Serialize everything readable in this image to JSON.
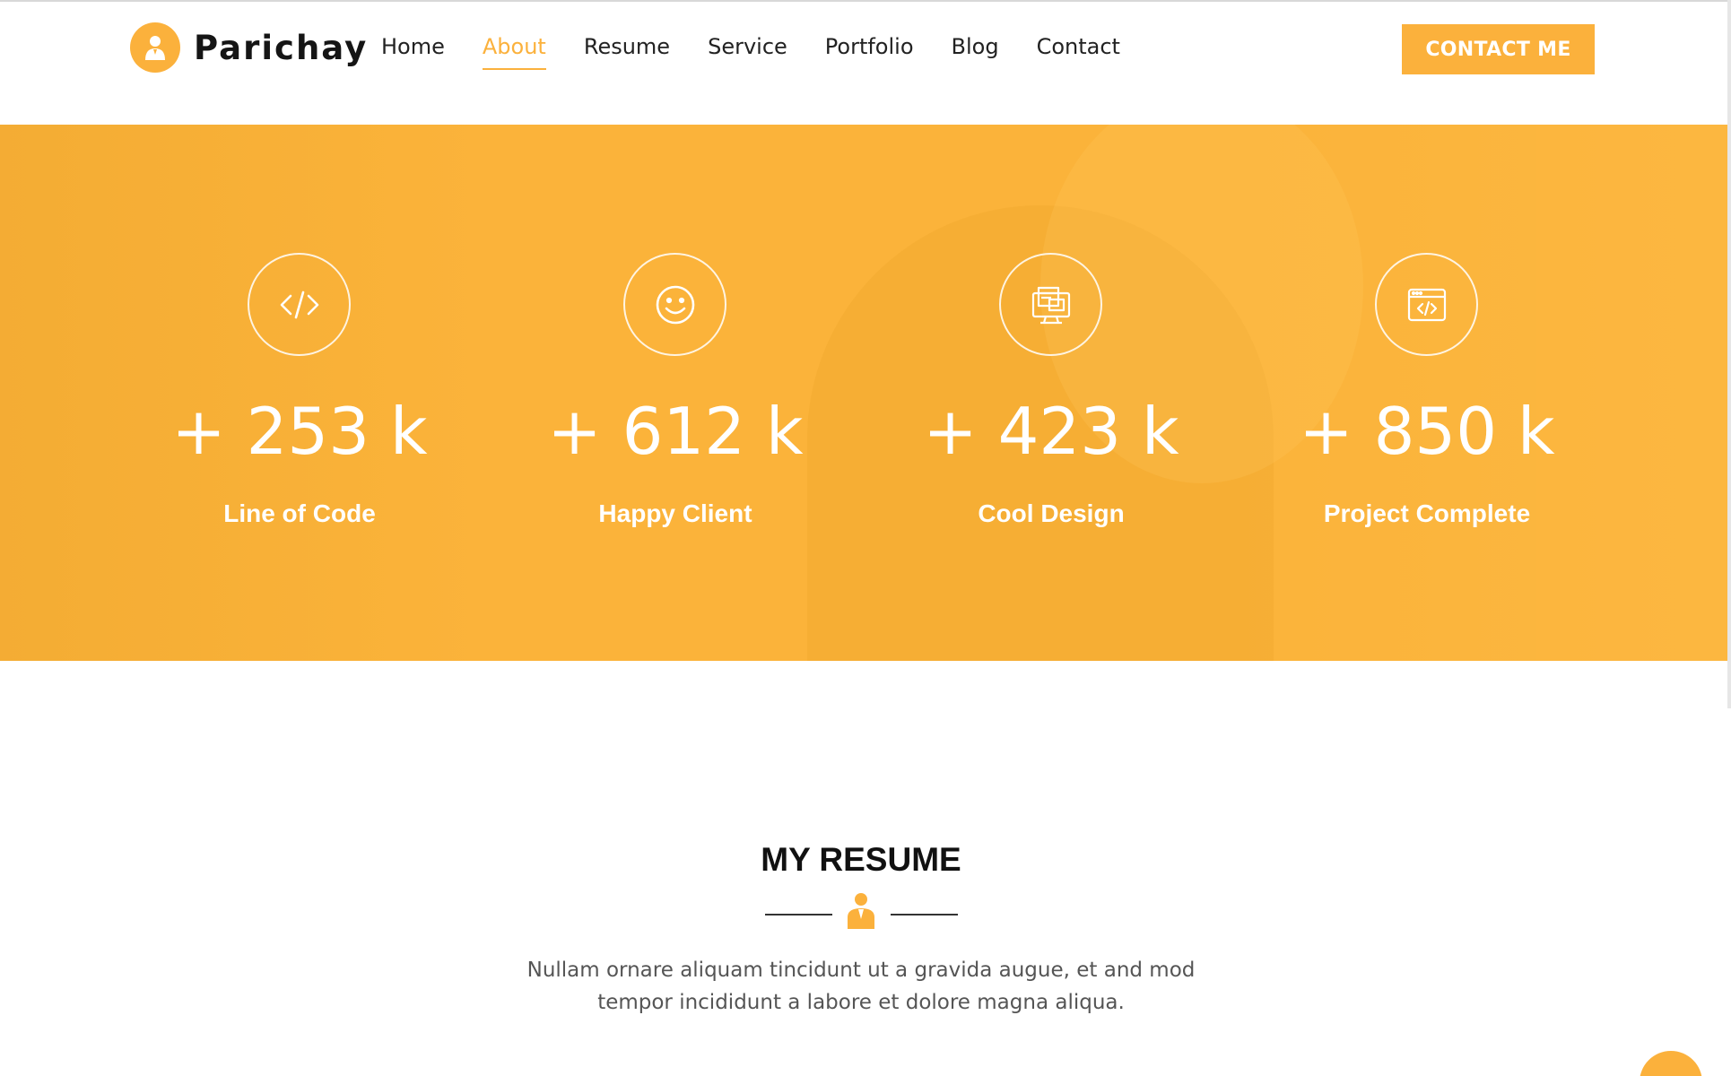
{
  "brand": {
    "name": "Parichay",
    "icon": "person-icon"
  },
  "nav": {
    "items": [
      {
        "label": "Home"
      },
      {
        "label": "About",
        "active": true
      },
      {
        "label": "Resume"
      },
      {
        "label": "Service"
      },
      {
        "label": "Portfolio"
      },
      {
        "label": "Blog"
      },
      {
        "label": "Contact"
      }
    ],
    "cta": "CONTACT ME"
  },
  "counters": [
    {
      "icon": "code-icon",
      "value": "+ 253 k",
      "label": "Line of Code"
    },
    {
      "icon": "smiley-icon",
      "value": "+ 612 k",
      "label": "Happy Client"
    },
    {
      "icon": "monitor-design-icon",
      "value": "+ 423 k",
      "label": "Cool Design"
    },
    {
      "icon": "browser-code-icon",
      "value": "+ 850 k",
      "label": "Project Complete"
    }
  ],
  "resume": {
    "title": "MY RESUME",
    "icon": "person-icon",
    "description_line1": "Nullam ornare aliquam tincidunt ut a gravida augue, et and mod",
    "description_line2": "tempor incididunt a labore et dolore magna aliqua."
  },
  "colors": {
    "accent": "#fbb13c",
    "band": "#fbb33a",
    "text": "#111111"
  }
}
